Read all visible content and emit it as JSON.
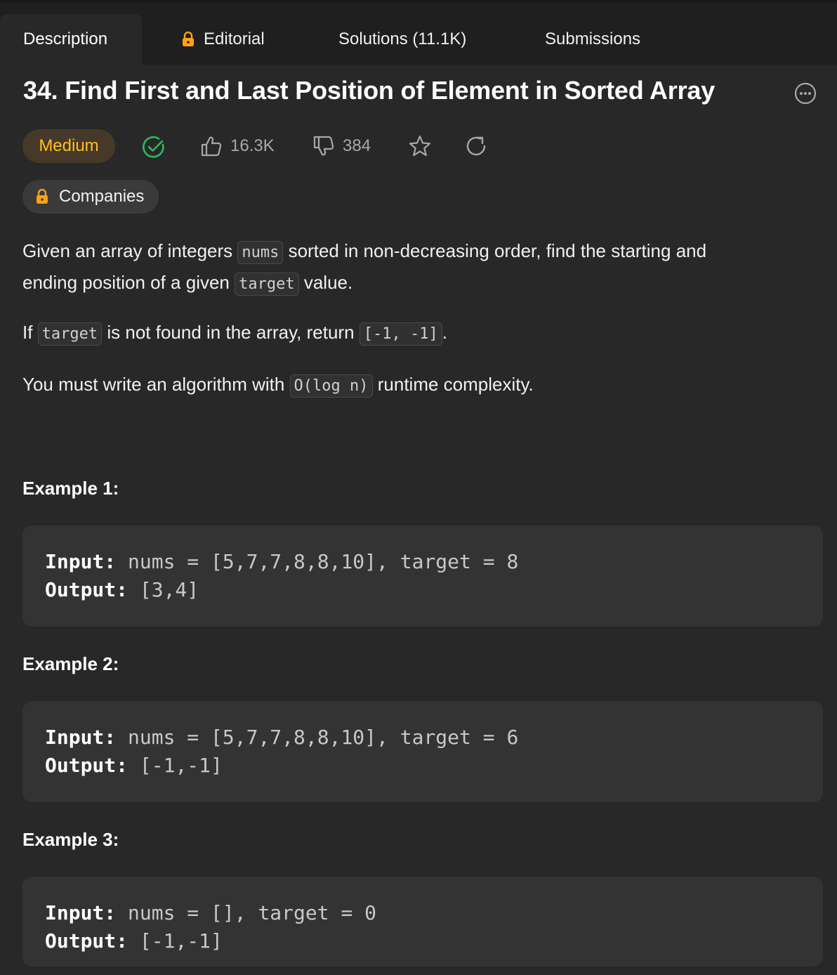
{
  "tabs": [
    {
      "label": "Description",
      "active": true
    },
    {
      "label": "Editorial",
      "locked": true
    },
    {
      "label": "Solutions (11.1K)"
    },
    {
      "label": "Submissions"
    }
  ],
  "problem": {
    "title": "34. Find First and Last Position of Element in Sorted Array",
    "difficulty": "Medium",
    "likes": "16.3K",
    "dislikes": "384",
    "companies_label": "Companies"
  },
  "description": {
    "p1_a": "Given an array of integers ",
    "p1_code1": "nums",
    "p1_b": " sorted in non-decreasing order, find the starting and",
    "p1_c": "ending position of a given ",
    "p1_code2": "target",
    "p1_d": " value.",
    "p2_a": "If ",
    "p2_code1": "target",
    "p2_b": " is not found in the array, return ",
    "p2_code2": "[-1, -1]",
    "p2_c": ".",
    "p3_a": "You must write an algorithm with ",
    "p3_code": "O(log n)",
    "p3_b": " runtime complexity."
  },
  "examples": [
    {
      "title": "Example 1:",
      "input_label": "Input:",
      "input": " nums = [5,7,7,8,8,10], target = 8",
      "output_label": "Output:",
      "output": " [3,4]"
    },
    {
      "title": "Example 2:",
      "input_label": "Input:",
      "input": " nums = [5,7,7,8,8,10], target = 6",
      "output_label": "Output:",
      "output": " [-1,-1]"
    },
    {
      "title": "Example 3:",
      "input_label": "Input:",
      "input": " nums = [], target = 0",
      "output_label": "Output:",
      "output": " [-1,-1]"
    }
  ],
  "colors": {
    "background": "#282828",
    "tabbar": "#1f1f1f",
    "medium": "#ffc01e",
    "solved": "#2cbb5d",
    "lock": "#ffa116"
  }
}
